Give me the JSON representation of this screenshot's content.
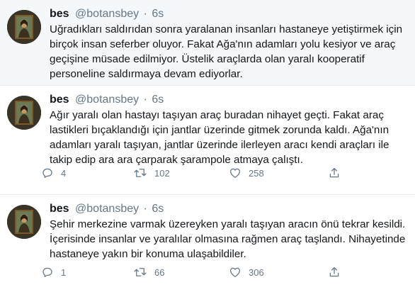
{
  "tweets": [
    {
      "name": "bes",
      "handle": "@botansbey",
      "dot": "·",
      "time": "6s",
      "text": "Uğradıkları saldırıdan sonra yaralanan insanları hastaneye yetiştirmek için\nbirçok insan seferber oluyor. Fakat Ağa'nın adamları yolu kesiyor ve araç\ngeçişine müsade edilmiyor. Üstelik araçlarda olan yaralı kooperatif\npersoneline saldırmaya devam ediyorlar."
    },
    {
      "name": "bes",
      "handle": "@botansbey",
      "dot": "·",
      "time": "6s",
      "text": "Ağır yaralı olan hastayı taşıyan araç buradan nihayet geçti. Fakat araç\nlastikleri bıçaklandığı için jantlar üzerinde gitmek zorunda kaldı. Ağa'nın\nadamları yaralı taşıyan, jantlar üzerinde ilerleyen aracı kendi araçları ile\ntakip edip ara ara çarparak şarampole atmaya çalıştı.",
      "replies": "4",
      "retweets": "102",
      "likes": "258"
    },
    {
      "name": "bes",
      "handle": "@botansbey",
      "dot": "·",
      "time": "6s",
      "text": "Şehir merkezine varmak üzereyken yaralı taşıyan aracın önü tekrar kesildi.\nİçerisinde insanlar ve yaralılar olmasına rağmen araç taşlandı. Nihayetinde\nhastaneye yakın bir konuma ulaşabildiler.",
      "replies": "1",
      "retweets": "66",
      "likes": "306"
    }
  ],
  "icons": {
    "reply": "reply-icon",
    "retweet": "retweet-icon",
    "like": "heart-icon",
    "share": "share-icon",
    "avatar": "mona-lisa-avatar"
  },
  "colors": {
    "highlight_bg": "#f5f8fa",
    "text": "#14171a",
    "muted": "#657786",
    "divider": "#e6ecf0"
  }
}
